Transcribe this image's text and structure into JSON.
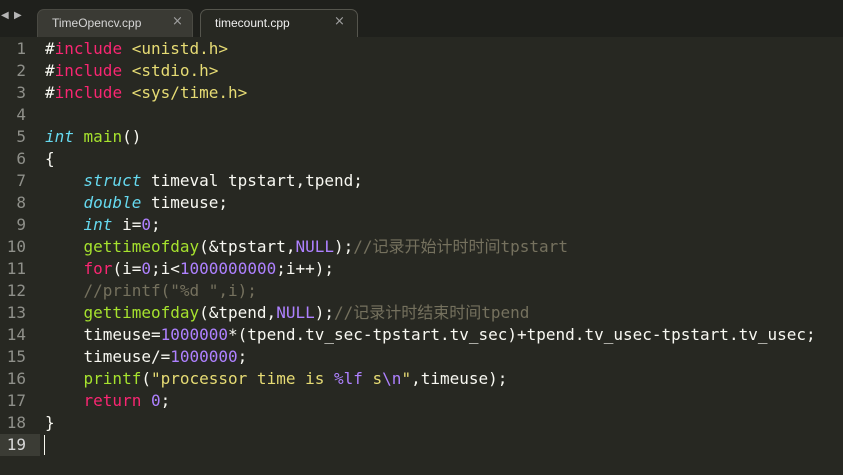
{
  "tabs": [
    {
      "label": "TimeOpencv.cpp",
      "close": "×"
    },
    {
      "label": "timecount.cpp",
      "close": "×"
    }
  ],
  "nav": {
    "back": "◀",
    "forward": "▶"
  },
  "lines": [
    {
      "num": "1",
      "segs": [
        {
          "t": "#",
          "c": ""
        },
        {
          "t": "include",
          "c": "kw"
        },
        {
          "t": " ",
          "c": ""
        },
        {
          "t": "<unistd.h>",
          "c": "str"
        }
      ]
    },
    {
      "num": "2",
      "segs": [
        {
          "t": "#",
          "c": ""
        },
        {
          "t": "include",
          "c": "kw"
        },
        {
          "t": " ",
          "c": ""
        },
        {
          "t": "<stdio.h>",
          "c": "str"
        }
      ]
    },
    {
      "num": "3",
      "segs": [
        {
          "t": "#",
          "c": ""
        },
        {
          "t": "include",
          "c": "kw"
        },
        {
          "t": " ",
          "c": ""
        },
        {
          "t": "<sys/time.h>",
          "c": "str"
        }
      ]
    },
    {
      "num": "4",
      "segs": []
    },
    {
      "num": "5",
      "segs": [
        {
          "t": "int",
          "c": "type"
        },
        {
          "t": " ",
          "c": ""
        },
        {
          "t": "main",
          "c": "fn"
        },
        {
          "t": "()",
          "c": ""
        }
      ]
    },
    {
      "num": "6",
      "segs": [
        {
          "t": "{",
          "c": ""
        }
      ]
    },
    {
      "num": "7",
      "segs": [
        {
          "t": "    ",
          "c": ""
        },
        {
          "t": "struct",
          "c": "type"
        },
        {
          "t": " timeval tpstart,tpend;",
          "c": ""
        }
      ]
    },
    {
      "num": "8",
      "segs": [
        {
          "t": "    ",
          "c": ""
        },
        {
          "t": "double",
          "c": "type"
        },
        {
          "t": " timeuse;",
          "c": ""
        }
      ]
    },
    {
      "num": "9",
      "segs": [
        {
          "t": "    ",
          "c": ""
        },
        {
          "t": "int",
          "c": "type"
        },
        {
          "t": " i=",
          "c": ""
        },
        {
          "t": "0",
          "c": "num"
        },
        {
          "t": ";",
          "c": ""
        }
      ]
    },
    {
      "num": "10",
      "segs": [
        {
          "t": "    ",
          "c": ""
        },
        {
          "t": "gettimeofday",
          "c": "fn"
        },
        {
          "t": "(&tpstart,",
          "c": ""
        },
        {
          "t": "NULL",
          "c": "num"
        },
        {
          "t": ");",
          "c": ""
        },
        {
          "t": "//记录开始计时时间tpstart",
          "c": "cmt"
        }
      ]
    },
    {
      "num": "11",
      "segs": [
        {
          "t": "    ",
          "c": ""
        },
        {
          "t": "for",
          "c": "kw"
        },
        {
          "t": "(i=",
          "c": ""
        },
        {
          "t": "0",
          "c": "num"
        },
        {
          "t": ";i<",
          "c": ""
        },
        {
          "t": "1000000000",
          "c": "num"
        },
        {
          "t": ";i++);",
          "c": ""
        }
      ]
    },
    {
      "num": "12",
      "segs": [
        {
          "t": "    ",
          "c": ""
        },
        {
          "t": "//printf(\"%d \",i);",
          "c": "cmt"
        }
      ]
    },
    {
      "num": "13",
      "segs": [
        {
          "t": "    ",
          "c": ""
        },
        {
          "t": "gettimeofday",
          "c": "fn"
        },
        {
          "t": "(&tpend,",
          "c": ""
        },
        {
          "t": "NULL",
          "c": "num"
        },
        {
          "t": ");",
          "c": ""
        },
        {
          "t": "//记录计时结束时间tpend",
          "c": "cmt"
        }
      ]
    },
    {
      "num": "14",
      "segs": [
        {
          "t": "    timeuse=",
          "c": ""
        },
        {
          "t": "1000000",
          "c": "num"
        },
        {
          "t": "*(tpend.tv_sec-tpstart.tv_sec)+tpend.tv_usec-tpstart.tv_usec;",
          "c": ""
        }
      ]
    },
    {
      "num": "15",
      "segs": [
        {
          "t": "    timeuse/=",
          "c": ""
        },
        {
          "t": "1000000",
          "c": "num"
        },
        {
          "t": ";",
          "c": ""
        }
      ]
    },
    {
      "num": "16",
      "segs": [
        {
          "t": "    ",
          "c": ""
        },
        {
          "t": "printf",
          "c": "fn"
        },
        {
          "t": "(",
          "c": ""
        },
        {
          "t": "\"processor time is ",
          "c": "str"
        },
        {
          "t": "%lf",
          "c": "num"
        },
        {
          "t": " s",
          "c": "str"
        },
        {
          "t": "\\n",
          "c": "num"
        },
        {
          "t": "\"",
          "c": "str"
        },
        {
          "t": ",timeuse);",
          "c": ""
        }
      ]
    },
    {
      "num": "17",
      "segs": [
        {
          "t": "    ",
          "c": ""
        },
        {
          "t": "return",
          "c": "kw"
        },
        {
          "t": " ",
          "c": ""
        },
        {
          "t": "0",
          "c": "num"
        },
        {
          "t": ";",
          "c": ""
        }
      ]
    },
    {
      "num": "18",
      "segs": [
        {
          "t": "}",
          "c": ""
        }
      ]
    },
    {
      "num": "19",
      "segs": []
    }
  ],
  "current_line": "19"
}
